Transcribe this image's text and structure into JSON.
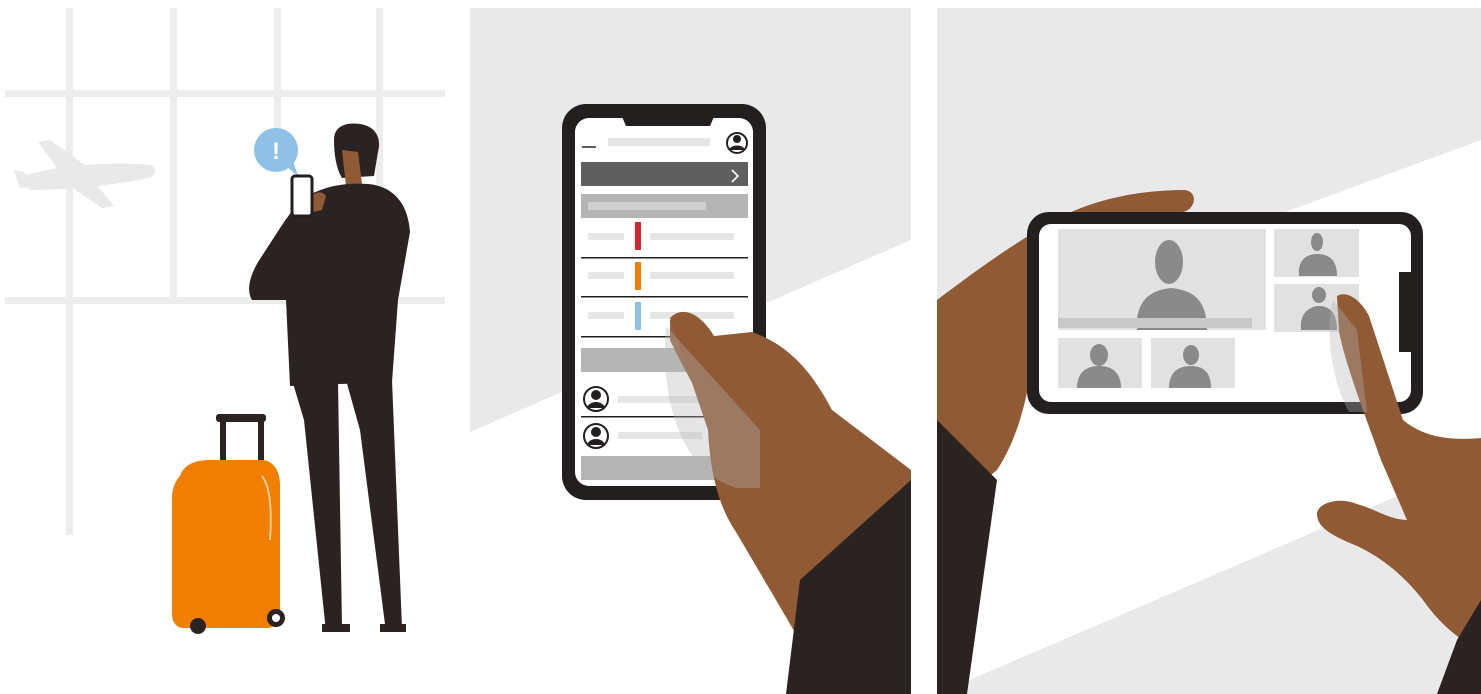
{
  "colors": {
    "background": "#ffffff",
    "light_gray": "#e9e9ea",
    "window_frame": "#ededed",
    "suit": "#2b2321",
    "skin": "#905a35",
    "skin_dark": "#3a261d",
    "luggage": "#f07e00",
    "luggage_handle": "#2b2321",
    "notification": "#8fc1e6",
    "phone_frame": "#231f1f",
    "screen_bar_dark": "#5f5f5f",
    "screen_bar_mid": "#b5b5b5",
    "screen_line_light": "#e6e6e6",
    "status_red": "#d8262f",
    "status_orange": "#f07e00",
    "status_blue": "#8fc1e6",
    "video_tile": "#e1e1e1",
    "person_silhouette": "#8a8a8a"
  },
  "scenes": [
    {
      "name": "traveler-at-airport",
      "icons": [
        "airplane-icon",
        "notification-bubble-icon",
        "smartphone-icon",
        "suitcase-icon"
      ]
    },
    {
      "name": "phone-app-portrait",
      "icons": [
        "user-avatar-icon",
        "chevron-right-icon"
      ],
      "status_indicators": [
        "red",
        "orange",
        "blue"
      ],
      "contacts": 2
    },
    {
      "name": "video-call-landscape",
      "participants": 5
    }
  ],
  "notification": {
    "symbol": "!"
  }
}
